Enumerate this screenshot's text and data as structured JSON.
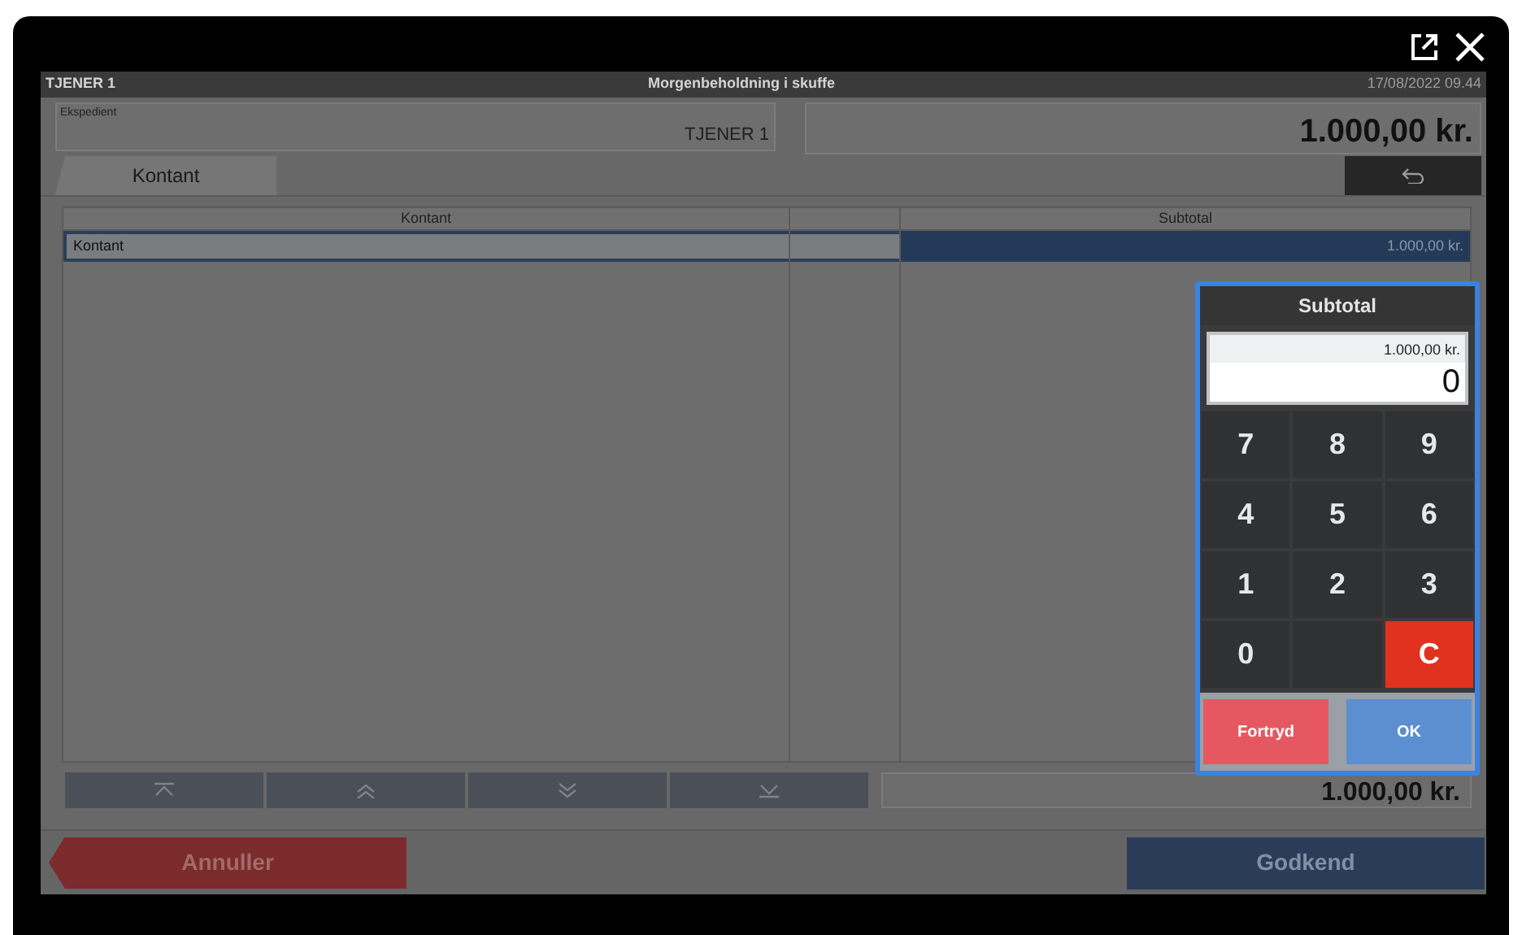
{
  "header": {
    "user": "TJENER 1",
    "title": "Morgenbeholdning i skuffe",
    "datetime": "17/08/2022 09.44"
  },
  "clerk": {
    "label": "Ekspedient",
    "value": "TJENER 1"
  },
  "total": "1.000,00 kr.",
  "tabs": [
    {
      "label": "Kontant",
      "selected": true
    }
  ],
  "table": {
    "columns": [
      "Kontant",
      "Subtotal"
    ],
    "rows": [
      {
        "name": "Kontant",
        "subtotal": "1.000,00 kr.",
        "selected": true
      }
    ]
  },
  "footer_total": "1.000,00 kr.",
  "keypad": {
    "title": "Subtotal",
    "reference": "1.000,00 kr.",
    "value": "0",
    "keys": [
      {
        "label": "7",
        "kind": "digit"
      },
      {
        "label": "8",
        "kind": "digit"
      },
      {
        "label": "9",
        "kind": "digit"
      },
      {
        "label": "4",
        "kind": "digit"
      },
      {
        "label": "5",
        "kind": "digit"
      },
      {
        "label": "6",
        "kind": "digit"
      },
      {
        "label": "1",
        "kind": "digit"
      },
      {
        "label": "2",
        "kind": "digit"
      },
      {
        "label": "3",
        "kind": "digit"
      },
      {
        "label": "0",
        "kind": "digit"
      },
      {
        "kind": "blank"
      },
      {
        "label": "C",
        "kind": "clear"
      }
    ],
    "actions": [
      {
        "label": "Fortryd",
        "kind": "cancel"
      },
      {
        "label": "OK",
        "kind": "confirm"
      }
    ]
  },
  "buttons": [
    {
      "label": "Annuller",
      "kind": "cancel"
    },
    {
      "label": "Godkend",
      "kind": "confirm"
    }
  ]
}
